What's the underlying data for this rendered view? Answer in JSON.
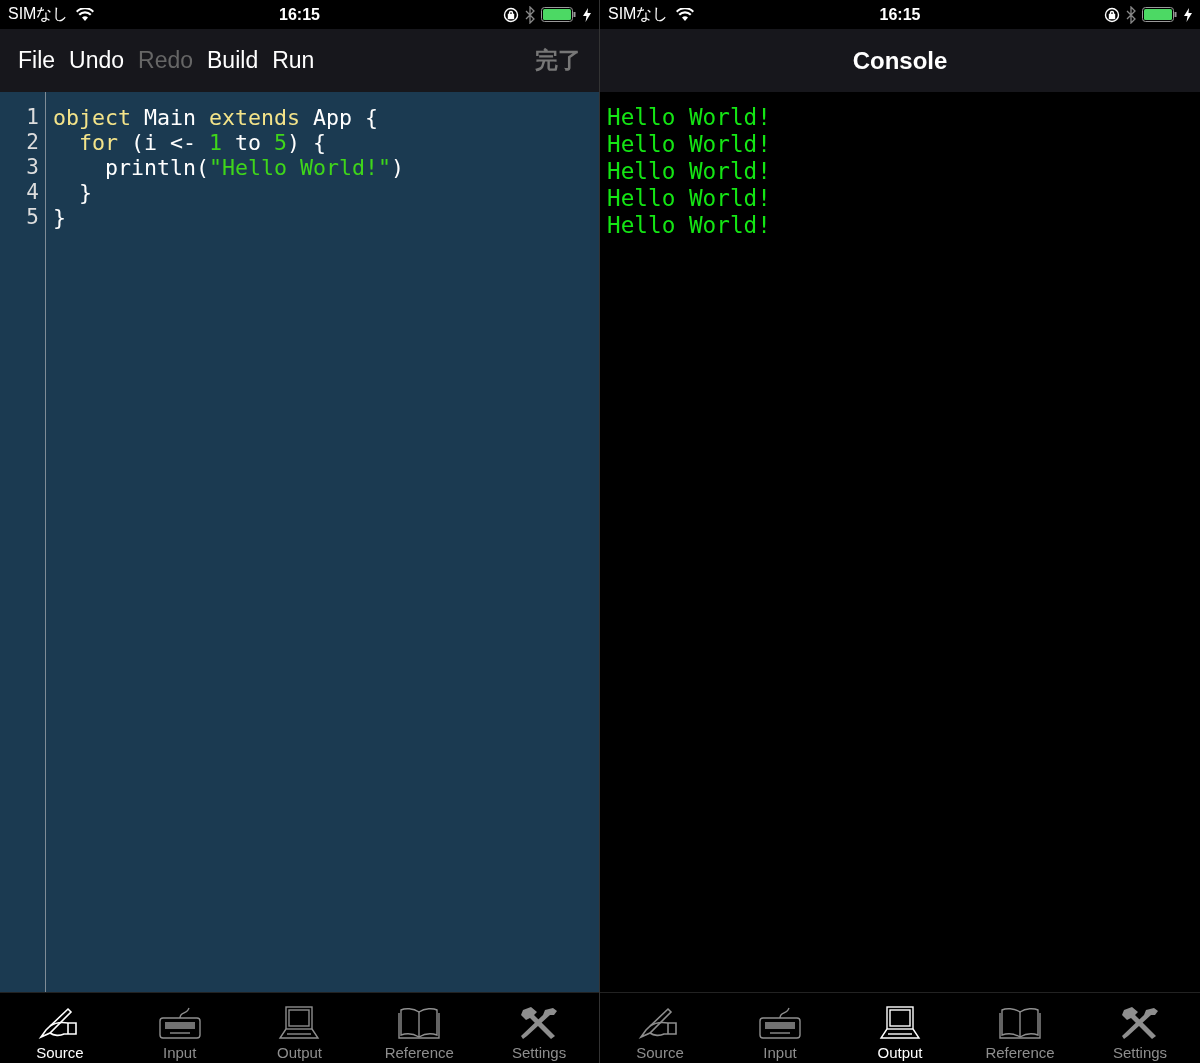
{
  "screens": [
    {
      "status_bar": {
        "carrier": "SIMなし",
        "time": "16:15"
      },
      "toolbar": {
        "kind": "editor",
        "items": [
          {
            "label": "File",
            "disabled": false
          },
          {
            "label": "Undo",
            "disabled": false
          },
          {
            "label": "Redo",
            "disabled": true
          },
          {
            "label": "Build",
            "disabled": false
          },
          {
            "label": "Run",
            "disabled": false
          }
        ],
        "done": {
          "label": "完了",
          "disabled": true
        }
      },
      "editor": {
        "lines": [
          {
            "number": "1",
            "tokens": [
              {
                "kind": "keyword",
                "text": "object"
              },
              {
                "kind": "plain",
                "text": " Main "
              },
              {
                "kind": "keyword",
                "text": "extends"
              },
              {
                "kind": "plain",
                "text": " App {"
              }
            ]
          },
          {
            "number": "2",
            "tokens": [
              {
                "kind": "keyword",
                "text": "  for"
              },
              {
                "kind": "plain",
                "text": " (i <- "
              },
              {
                "kind": "number",
                "text": "1"
              },
              {
                "kind": "plain",
                "text": " to "
              },
              {
                "kind": "number",
                "text": "5"
              },
              {
                "kind": "plain",
                "text": ") {"
              }
            ]
          },
          {
            "number": "3",
            "tokens": [
              {
                "kind": "plain",
                "text": "    println("
              },
              {
                "kind": "string",
                "text": "\"Hello World!\""
              },
              {
                "kind": "plain",
                "text": ")"
              }
            ]
          },
          {
            "number": "4",
            "tokens": [
              {
                "kind": "plain",
                "text": "  }"
              }
            ]
          },
          {
            "number": "5",
            "tokens": [
              {
                "kind": "plain",
                "text": "}"
              }
            ]
          }
        ]
      },
      "tabs": [
        {
          "label": "Source",
          "selected": true
        },
        {
          "label": "Input",
          "selected": false
        },
        {
          "label": "Output",
          "selected": false
        },
        {
          "label": "Reference",
          "selected": false
        },
        {
          "label": "Settings",
          "selected": false
        }
      ]
    },
    {
      "status_bar": {
        "carrier": "SIMなし",
        "time": "16:15"
      },
      "toolbar": {
        "kind": "title",
        "title": "Console"
      },
      "console": {
        "lines": [
          "Hello World!",
          "Hello World!",
          "Hello World!",
          "Hello World!",
          "Hello World!"
        ]
      },
      "tabs": [
        {
          "label": "Source",
          "selected": false
        },
        {
          "label": "Input",
          "selected": false
        },
        {
          "label": "Output",
          "selected": true
        },
        {
          "label": "Reference",
          "selected": false
        },
        {
          "label": "Settings",
          "selected": false
        }
      ]
    }
  ]
}
